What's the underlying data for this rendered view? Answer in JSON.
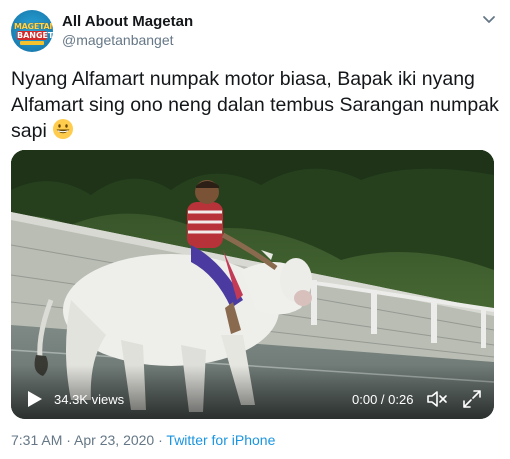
{
  "author": {
    "display_name": "All About Magetan",
    "handle": "@magetanbanget",
    "avatar_text_top": "MAGETAN",
    "avatar_text_bottom": "BANGET"
  },
  "tweet": {
    "text": "Nyang Alfamart numpak motor biasa, Bapak iki nyang Alfamart sing ono neng dalan tembus Sarangan numpak sapi",
    "emoji": "grinning-face-emoji"
  },
  "video": {
    "views": "34.3K views",
    "time": "0:00 / 0:26"
  },
  "meta": {
    "time": "7:31 AM",
    "separator1": " · ",
    "date": "Apr 23, 2020",
    "separator2": " · ",
    "source": "Twitter for iPhone"
  },
  "colors": {
    "text": "#14171a",
    "secondary": "#657786",
    "link": "#1b95e0"
  }
}
